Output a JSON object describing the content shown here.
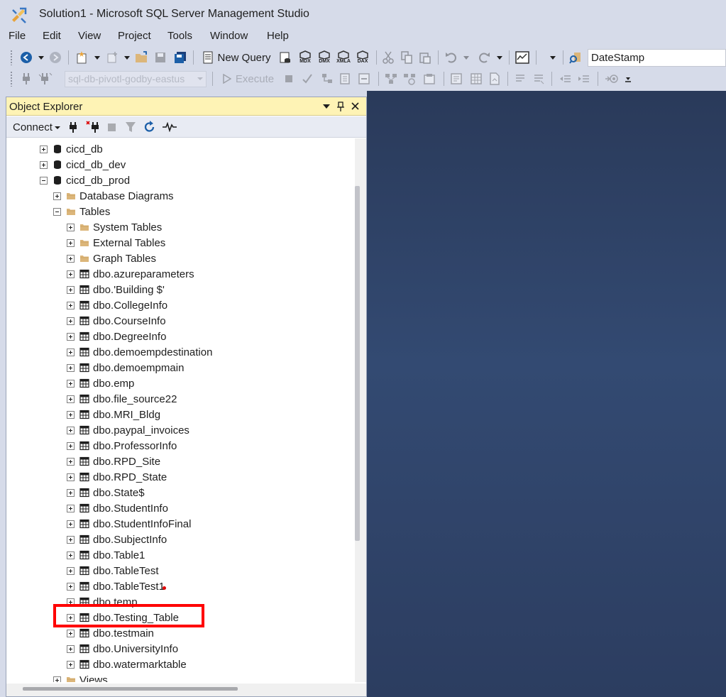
{
  "window": {
    "title": "Solution1 - Microsoft SQL Server Management Studio"
  },
  "menu": [
    "File",
    "Edit",
    "View",
    "Project",
    "Tools",
    "Window",
    "Help"
  ],
  "toolbar1": {
    "new_query_label": "New Query",
    "mode_icons": [
      "MDX",
      "DMX",
      "XMLA",
      "DAX"
    ],
    "find_value": "DateStamp"
  },
  "toolbar2": {
    "database_selected": "sql-db-pivotl-godby-eastus",
    "execute_label": "Execute"
  },
  "object_explorer": {
    "title": "Object Explorer",
    "connect_label": "Connect",
    "tree": [
      {
        "label": "cicd_db",
        "kind": "database",
        "expanded": false
      },
      {
        "label": "cicd_db_dev",
        "kind": "database",
        "expanded": false
      },
      {
        "label": "cicd_db_prod",
        "kind": "database",
        "expanded": true
      },
      {
        "label": "Database Diagrams",
        "kind": "folder",
        "expanded": false
      },
      {
        "label": "Tables",
        "kind": "folder",
        "expanded": true
      },
      {
        "label": "System Tables",
        "kind": "folder",
        "expanded": false
      },
      {
        "label": "External Tables",
        "kind": "folder",
        "expanded": false
      },
      {
        "label": "Graph Tables",
        "kind": "folder",
        "expanded": false
      },
      {
        "label": "dbo.azureparameters",
        "kind": "table",
        "expanded": false
      },
      {
        "label": "dbo.'Building $'",
        "kind": "table",
        "expanded": false
      },
      {
        "label": "dbo.CollegeInfo",
        "kind": "table",
        "expanded": false
      },
      {
        "label": "dbo.CourseInfo",
        "kind": "table",
        "expanded": false
      },
      {
        "label": "dbo.DegreeInfo",
        "kind": "table",
        "expanded": false
      },
      {
        "label": "dbo.demoempdestination",
        "kind": "table",
        "expanded": false
      },
      {
        "label": "dbo.demoempmain",
        "kind": "table",
        "expanded": false
      },
      {
        "label": "dbo.emp",
        "kind": "table",
        "expanded": false
      },
      {
        "label": "dbo.file_source22",
        "kind": "table",
        "expanded": false
      },
      {
        "label": "dbo.MRI_Bldg",
        "kind": "table",
        "expanded": false
      },
      {
        "label": "dbo.paypal_invoices",
        "kind": "table",
        "expanded": false
      },
      {
        "label": "dbo.ProfessorInfo",
        "kind": "table",
        "expanded": false
      },
      {
        "label": "dbo.RPD_Site",
        "kind": "table",
        "expanded": false
      },
      {
        "label": "dbo.RPD_State",
        "kind": "table",
        "expanded": false
      },
      {
        "label": "dbo.State$",
        "kind": "table",
        "expanded": false
      },
      {
        "label": "dbo.StudentInfo",
        "kind": "table",
        "expanded": false
      },
      {
        "label": "dbo.StudentInfoFinal",
        "kind": "table",
        "expanded": false
      },
      {
        "label": "dbo.SubjectInfo",
        "kind": "table",
        "expanded": false
      },
      {
        "label": "dbo.Table1",
        "kind": "table",
        "expanded": false
      },
      {
        "label": "dbo.TableTest",
        "kind": "table",
        "expanded": false
      },
      {
        "label": "dbo.TableTest1",
        "kind": "table",
        "expanded": false
      },
      {
        "label": "dbo.temp",
        "kind": "table",
        "expanded": false
      },
      {
        "label": "dbo.Testing_Table",
        "kind": "table",
        "expanded": false,
        "highlighted": true
      },
      {
        "label": "dbo.testmain",
        "kind": "table",
        "expanded": false
      },
      {
        "label": "dbo.UniversityInfo",
        "kind": "table",
        "expanded": false
      },
      {
        "label": "dbo.watermarktable",
        "kind": "table",
        "expanded": false
      },
      {
        "label": "Views",
        "kind": "folder",
        "expanded": false
      }
    ]
  },
  "colors": {
    "chrome": "#d6dbe9",
    "panel_title": "#fef3b5",
    "workspace": "#2c3d60",
    "highlight_box": "#ff0000",
    "folder": "#dcb67a"
  }
}
